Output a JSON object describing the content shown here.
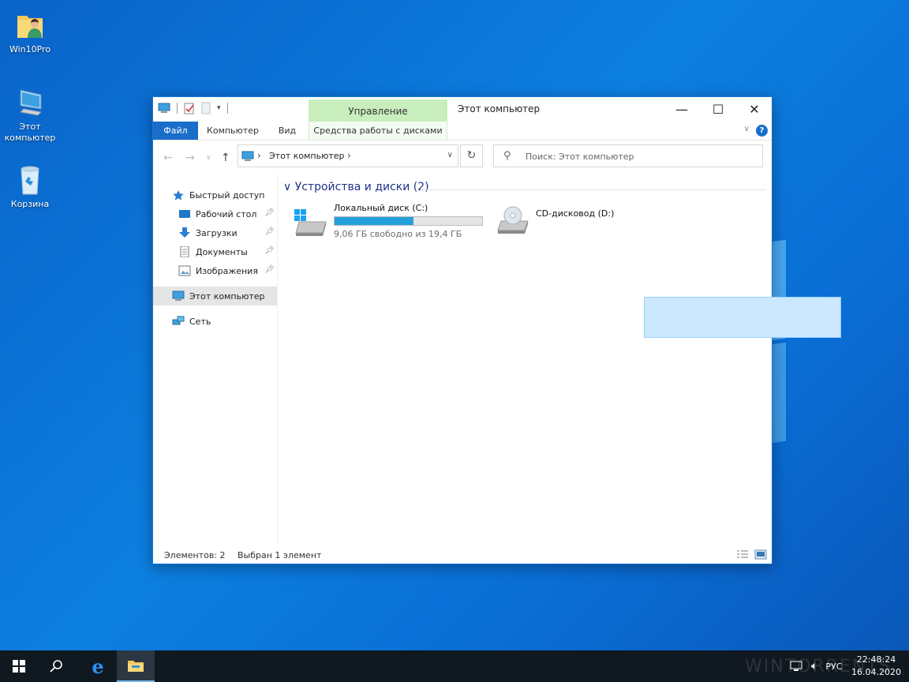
{
  "desktop": {
    "icons": [
      {
        "label": "Win10Pro",
        "icon": "user-folder-icon"
      },
      {
        "label": "Этот компьютер",
        "icon": "computer-icon"
      },
      {
        "label": "Корзина",
        "icon": "recycle-bin-icon"
      }
    ]
  },
  "window": {
    "title": "Этот компьютер",
    "context_tab": "Управление",
    "ribbon_tabs": [
      "Файл",
      "Компьютер",
      "Вид",
      "Средства работы с дисками"
    ],
    "controls": {
      "minimize": "—",
      "maximize": "☐",
      "close": "✕"
    },
    "help": "?",
    "address": {
      "location": "Этот компьютер"
    },
    "search": {
      "placeholder": "Поиск: Этот компьютер"
    },
    "nav": {
      "quick_access": "Быстрый доступ",
      "items": [
        "Рабочий стол",
        "Загрузки",
        "Документы",
        "Изображения"
      ],
      "this_pc": "Этот компьютер",
      "network": "Сеть"
    },
    "group": {
      "title": "Устройства и диски (2)"
    },
    "drives": [
      {
        "name": "Локальный диск (C:)",
        "free_text": "9,06 ГБ свободно из 19,4 ГБ",
        "used_fraction": 0.533
      },
      {
        "name": "CD-дисковод (D:)"
      }
    ],
    "status": {
      "items": "Элементов: 2",
      "selected": "Выбран 1 элемент"
    }
  },
  "taskbar": {
    "language": "РУС",
    "time": "22:48:24",
    "date": "16.04.2020",
    "watermark": "WINTORRENTS"
  },
  "colors": {
    "accent": "#1a6ec9",
    "selection": "#cce8ff",
    "drive_bar": "#26a0da",
    "manage_tab": "#c8eebe"
  }
}
